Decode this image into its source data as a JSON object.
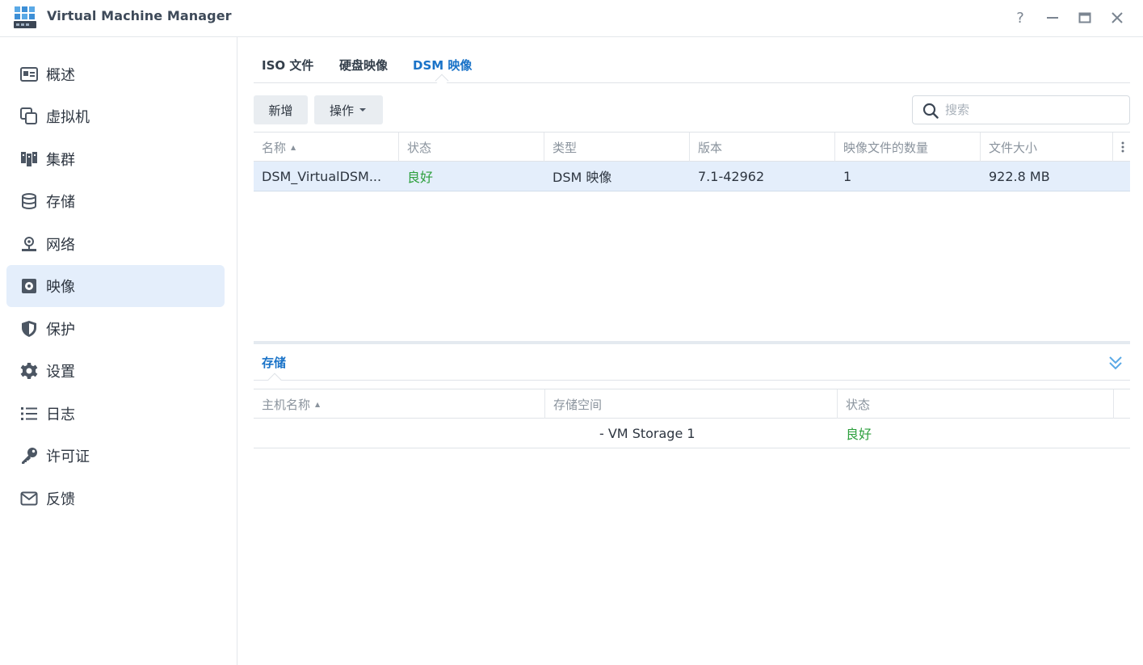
{
  "window": {
    "title": "Virtual Machine Manager",
    "help": "?",
    "minimize": "—",
    "maximize": "▭",
    "close": "✕"
  },
  "sidebar": {
    "items": [
      {
        "label": "概述",
        "icon": "overview-icon"
      },
      {
        "label": "虚拟机",
        "icon": "virtual-machine-icon"
      },
      {
        "label": "集群",
        "icon": "cluster-icon"
      },
      {
        "label": "存储",
        "icon": "storage-icon"
      },
      {
        "label": "网络",
        "icon": "network-icon"
      },
      {
        "label": "映像",
        "icon": "image-icon",
        "active": true
      },
      {
        "label": "保护",
        "icon": "shield-icon"
      },
      {
        "label": "设置",
        "icon": "gear-icon"
      },
      {
        "label": "日志",
        "icon": "list-icon"
      },
      {
        "label": "许可证",
        "icon": "key-icon"
      },
      {
        "label": "反馈",
        "icon": "mail-icon"
      }
    ]
  },
  "tabs": [
    {
      "label": "ISO 文件"
    },
    {
      "label": "硬盘映像"
    },
    {
      "label": "DSM 映像",
      "active": true
    }
  ],
  "toolbar": {
    "add_label": "新增",
    "action_label": "操作",
    "search_placeholder": "搜索"
  },
  "grid": {
    "columns": [
      "名称",
      "状态",
      "类型",
      "版本",
      "映像文件的数量",
      "文件大小"
    ],
    "rows": [
      {
        "name": "DSM_VirtualDSM...",
        "status": "良好",
        "type": "DSM 映像",
        "version": "7.1-42962",
        "count": "1",
        "size": "922.8 MB"
      }
    ]
  },
  "storage_panel": {
    "tab_label": "存储",
    "columns": [
      "主机名称",
      "存储空间",
      "状态"
    ],
    "rows": [
      {
        "host": "",
        "volume": "- VM Storage 1",
        "status": "良好"
      }
    ]
  },
  "colors": {
    "accent": "#1a73c8",
    "active_bg": "#e4eefb",
    "status_good": "#2ea03e"
  }
}
